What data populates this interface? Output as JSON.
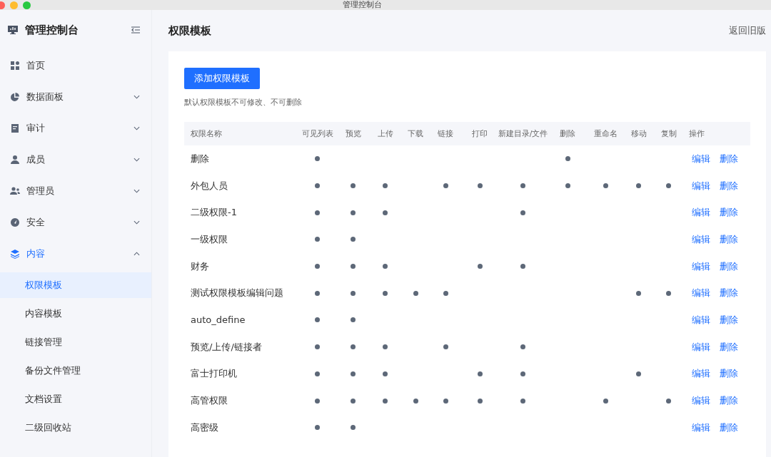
{
  "window": {
    "title": "管理控制台"
  },
  "sidebar": {
    "title": "管理控制台",
    "items": [
      {
        "label": "首页",
        "kind": "link",
        "selected": false
      },
      {
        "label": "数据面板",
        "kind": "group",
        "selected": false,
        "expanded": false
      },
      {
        "label": "审计",
        "kind": "group",
        "selected": false,
        "expanded": false
      },
      {
        "label": "成员",
        "kind": "group",
        "selected": false,
        "expanded": false
      },
      {
        "label": "管理员",
        "kind": "group",
        "selected": false,
        "expanded": false
      },
      {
        "label": "安全",
        "kind": "group",
        "selected": false,
        "expanded": false
      },
      {
        "label": "内容",
        "kind": "group",
        "selected": true,
        "expanded": true,
        "children": [
          {
            "label": "权限模板",
            "selected": true
          },
          {
            "label": "内容模板",
            "selected": false
          },
          {
            "label": "链接管理",
            "selected": false
          },
          {
            "label": "备份文件管理",
            "selected": false
          },
          {
            "label": "文档设置",
            "selected": false
          },
          {
            "label": "二级回收站",
            "selected": false
          }
        ]
      }
    ]
  },
  "page": {
    "title": "权限模板",
    "back_link": "返回旧版",
    "add_button": "添加权限模板",
    "note": "默认权限模板不可修改、不可删除"
  },
  "table": {
    "columns": [
      "权限名称",
      "可见列表",
      "预览",
      "上传",
      "下载",
      "链接",
      "打印",
      "新建目录/文件",
      "删除",
      "重命名",
      "移动",
      "复制",
      "操作"
    ],
    "rows": [
      {
        "name": "删除",
        "permissions": [
          true,
          false,
          false,
          false,
          false,
          false,
          false,
          true,
          false,
          false,
          false
        ],
        "actions": [
          "编辑",
          "删除"
        ]
      },
      {
        "name": "外包人员",
        "permissions": [
          true,
          true,
          true,
          false,
          true,
          true,
          true,
          true,
          true,
          true,
          true
        ],
        "actions": [
          "编辑",
          "删除"
        ]
      },
      {
        "name": "二级权限-1",
        "permissions": [
          true,
          true,
          true,
          false,
          false,
          false,
          true,
          false,
          false,
          false,
          false
        ],
        "actions": [
          "编辑",
          "删除"
        ]
      },
      {
        "name": "一级权限",
        "permissions": [
          true,
          true,
          false,
          false,
          false,
          false,
          false,
          false,
          false,
          false,
          false
        ],
        "actions": [
          "编辑",
          "删除"
        ]
      },
      {
        "name": "财务",
        "permissions": [
          true,
          true,
          true,
          false,
          false,
          true,
          true,
          false,
          false,
          false,
          false
        ],
        "actions": [
          "编辑",
          "删除"
        ]
      },
      {
        "name": "测试权限模板编辑问题",
        "permissions": [
          true,
          true,
          true,
          true,
          true,
          false,
          false,
          false,
          false,
          true,
          true
        ],
        "actions": [
          "编辑",
          "删除"
        ]
      },
      {
        "name": "auto_define",
        "permissions": [
          true,
          true,
          false,
          false,
          false,
          false,
          false,
          false,
          false,
          false,
          false
        ],
        "actions": [
          "编辑",
          "删除"
        ]
      },
      {
        "name": "预览/上传/链接者",
        "permissions": [
          true,
          true,
          true,
          false,
          true,
          false,
          true,
          false,
          false,
          false,
          false
        ],
        "actions": [
          "编辑",
          "删除"
        ]
      },
      {
        "name": "富士打印机",
        "permissions": [
          true,
          true,
          true,
          false,
          false,
          true,
          true,
          false,
          false,
          true,
          false
        ],
        "actions": [
          "编辑",
          "删除"
        ]
      },
      {
        "name": "高管权限",
        "permissions": [
          true,
          true,
          true,
          true,
          true,
          true,
          true,
          false,
          true,
          false,
          true
        ],
        "actions": [
          "编辑",
          "删除"
        ]
      },
      {
        "name": "高密级",
        "permissions": [
          true,
          true,
          false,
          false,
          false,
          false,
          false,
          false,
          false,
          false,
          false
        ],
        "actions": [
          "编辑",
          "删除"
        ]
      }
    ]
  }
}
